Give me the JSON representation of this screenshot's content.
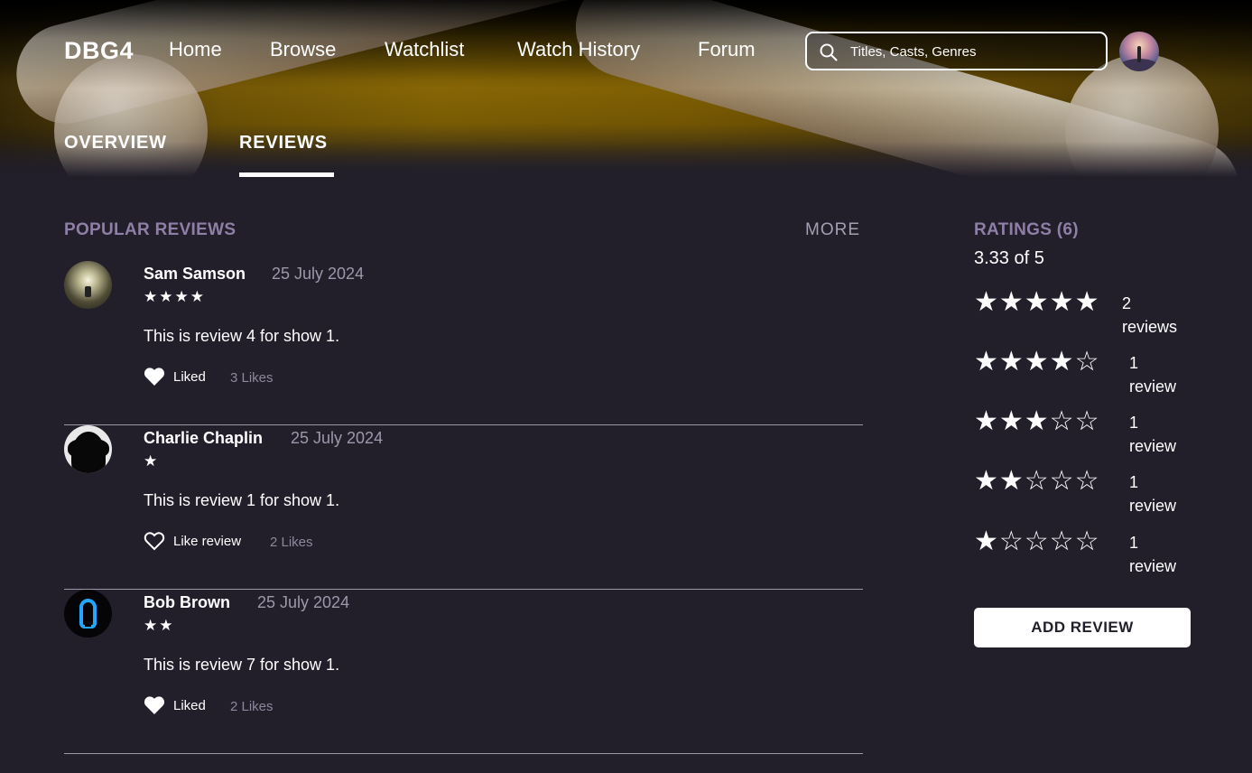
{
  "header": {
    "logo": "DBG4",
    "nav": [
      "Home",
      "Browse",
      "Watchlist",
      "Watch History",
      "Forum"
    ],
    "search_placeholder": "Titles, Casts, Genres"
  },
  "tabs": {
    "overview": "OVERVIEW",
    "reviews": "REVIEWS",
    "active": "REVIEWS"
  },
  "popular_reviews": {
    "title": "POPULAR REVIEWS",
    "more_label": "MORE",
    "items": [
      {
        "name": "Sam Samson",
        "date": "25 July 2024",
        "stars": "★★★★",
        "rating": 4,
        "text": "This is review 4 for show 1.",
        "like_label": "Liked",
        "liked": true,
        "likes": "3 Likes"
      },
      {
        "name": "Charlie Chaplin",
        "date": "25 July 2024",
        "stars": "★",
        "rating": 1,
        "text": "This is review 1 for show 1.",
        "like_label": "Like review",
        "liked": false,
        "likes": "2 Likes"
      },
      {
        "name": "Bob Brown",
        "date": "25 July 2024",
        "stars": "★★",
        "rating": 2,
        "text": "This is review 7 for show 1.",
        "like_label": "Liked",
        "liked": true,
        "likes": "2 Likes"
      }
    ]
  },
  "ratings": {
    "title": "RATINGS (6)",
    "average": "3.33 of 5",
    "breakdown": [
      {
        "stars": "★★★★★",
        "rating": 5,
        "count": "2",
        "unit": "reviews"
      },
      {
        "stars": "★★★★☆",
        "rating": 4,
        "count": "1",
        "unit": "review"
      },
      {
        "stars": "★★★☆☆",
        "rating": 3,
        "count": "1",
        "unit": "review"
      },
      {
        "stars": "★★☆☆☆",
        "rating": 2,
        "count": "1",
        "unit": "review"
      },
      {
        "stars": "★☆☆☆☆",
        "rating": 1,
        "count": "1",
        "unit": "review"
      }
    ],
    "add_review_label": "ADD REVIEW"
  },
  "colors": {
    "background": "#221f2b",
    "section_title": "#8f7fa6",
    "muted_text": "#9d98aa"
  }
}
